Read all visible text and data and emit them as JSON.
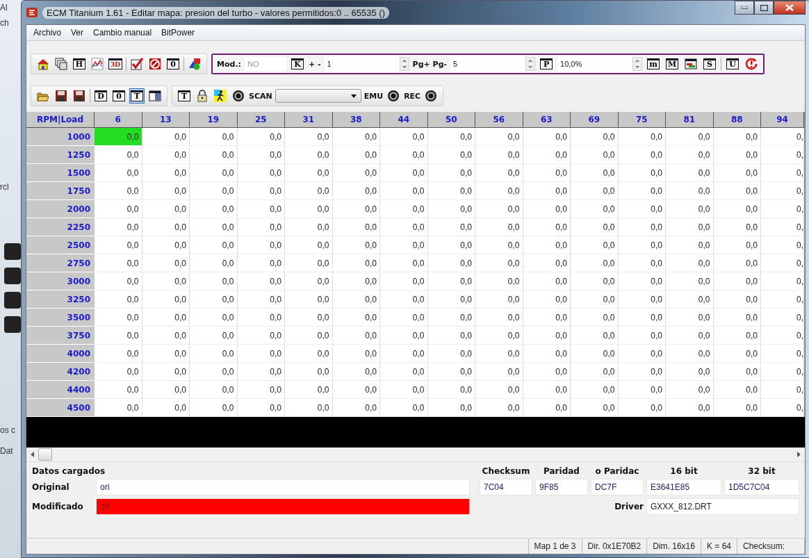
{
  "background_app": {
    "texts": [
      "Al",
      "ch",
      "rcl",
      "os c",
      "Dat"
    ]
  },
  "window": {
    "title": "ECM Titanium 1.61 - Editar mapa: presion del turbo - valores permitidos:0 .. 65535 ()"
  },
  "menu": [
    "Archivo",
    "Ver",
    "Cambio manual",
    "BitPower"
  ],
  "toolbar_1": {
    "buttons": [
      {
        "kind": "home"
      },
      {
        "kind": "pages"
      },
      {
        "kind": "letter",
        "glyph": "H"
      },
      {
        "kind": "chart"
      },
      {
        "kind": "letter",
        "glyph": "3D"
      },
      {
        "kind": "sep"
      },
      {
        "kind": "check"
      },
      {
        "kind": "forbid"
      },
      {
        "kind": "letter",
        "glyph": "0"
      },
      {
        "kind": "sep"
      },
      {
        "kind": "shapes"
      }
    ],
    "edit_bar": [
      {
        "kind": "label",
        "text": "Mod.:"
      },
      {
        "kind": "field",
        "value": "NO",
        "disabled": true
      },
      {
        "kind": "letter",
        "glyph": "K"
      },
      {
        "kind": "label",
        "text": "+ -"
      },
      {
        "kind": "spin",
        "value": "1",
        "disabled": false
      },
      {
        "kind": "label",
        "text": "Pg+ Pg-"
      },
      {
        "kind": "spin",
        "value": "5",
        "disabled": false
      },
      {
        "kind": "letter",
        "glyph": "P"
      },
      {
        "kind": "spin",
        "value": "10,0%",
        "disabled": false
      },
      {
        "kind": "letter",
        "glyph": "m"
      },
      {
        "kind": "letter",
        "glyph": "M"
      },
      {
        "kind": "colorbar"
      },
      {
        "kind": "letter",
        "glyph": "S"
      },
      {
        "kind": "sep"
      },
      {
        "kind": "letter",
        "glyph": "U"
      },
      {
        "kind": "power"
      }
    ]
  },
  "toolbar_2": {
    "buttons": [
      {
        "kind": "open",
        "pressed": false
      },
      {
        "kind": "save",
        "pressed": false
      },
      {
        "kind": "save",
        "pressed": false
      },
      {
        "kind": "sep"
      },
      {
        "kind": "letter",
        "glyph": "D",
        "pressed": false
      },
      {
        "kind": "letter",
        "glyph": "0",
        "pressed": false
      },
      {
        "kind": "letter",
        "glyph": "T",
        "pressed": true
      },
      {
        "kind": "panel",
        "pressed": false
      }
    ],
    "tools": [
      {
        "kind": "letter",
        "glyph": "T"
      },
      {
        "kind": "lock"
      },
      {
        "kind": "runner"
      },
      {
        "kind": "record"
      },
      {
        "kind": "label",
        "text": "SCAN"
      },
      {
        "kind": "dropdown"
      },
      {
        "kind": "label",
        "text": "EMU"
      },
      {
        "kind": "record"
      },
      {
        "kind": "label",
        "text": "REC"
      },
      {
        "kind": "record"
      }
    ]
  },
  "table": {
    "corner": "RPM|Load",
    "columns": [
      "6",
      "13",
      "19",
      "25",
      "31",
      "38",
      "44",
      "50",
      "56",
      "63",
      "69",
      "75",
      "81",
      "88",
      "94"
    ],
    "rows": [
      {
        "rpm": "1000",
        "cells": [
          {
            "value": "0,0",
            "selected": true
          },
          {
            "value": "0,0",
            "selected": false
          },
          {
            "value": "0,0",
            "selected": false
          },
          {
            "value": "0,0",
            "selected": false
          },
          {
            "value": "0,0",
            "selected": false
          },
          {
            "value": "0,0",
            "selected": false
          },
          {
            "value": "0,0",
            "selected": false
          },
          {
            "value": "0,0",
            "selected": false
          },
          {
            "value": "0,0",
            "selected": false
          },
          {
            "value": "0,0",
            "selected": false
          },
          {
            "value": "0,0",
            "selected": false
          },
          {
            "value": "0,0",
            "selected": false
          },
          {
            "value": "0,0",
            "selected": false
          },
          {
            "value": "0,0",
            "selected": false
          },
          {
            "value": "0,",
            "selected": false
          }
        ]
      },
      {
        "rpm": "1250",
        "cells": [
          {
            "value": "0,0",
            "selected": false
          },
          {
            "value": "0,0",
            "selected": false
          },
          {
            "value": "0,0",
            "selected": false
          },
          {
            "value": "0,0",
            "selected": false
          },
          {
            "value": "0,0",
            "selected": false
          },
          {
            "value": "0,0",
            "selected": false
          },
          {
            "value": "0,0",
            "selected": false
          },
          {
            "value": "0,0",
            "selected": false
          },
          {
            "value": "0,0",
            "selected": false
          },
          {
            "value": "0,0",
            "selected": false
          },
          {
            "value": "0,0",
            "selected": false
          },
          {
            "value": "0,0",
            "selected": false
          },
          {
            "value": "0,0",
            "selected": false
          },
          {
            "value": "0,0",
            "selected": false
          },
          {
            "value": "0,",
            "selected": false
          }
        ]
      },
      {
        "rpm": "1500",
        "cells": [
          {
            "value": "0,0",
            "selected": false
          },
          {
            "value": "0,0",
            "selected": false
          },
          {
            "value": "0,0",
            "selected": false
          },
          {
            "value": "0,0",
            "selected": false
          },
          {
            "value": "0,0",
            "selected": false
          },
          {
            "value": "0,0",
            "selected": false
          },
          {
            "value": "0,0",
            "selected": false
          },
          {
            "value": "0,0",
            "selected": false
          },
          {
            "value": "0,0",
            "selected": false
          },
          {
            "value": "0,0",
            "selected": false
          },
          {
            "value": "0,0",
            "selected": false
          },
          {
            "value": "0,0",
            "selected": false
          },
          {
            "value": "0,0",
            "selected": false
          },
          {
            "value": "0,0",
            "selected": false
          },
          {
            "value": "0,",
            "selected": false
          }
        ]
      },
      {
        "rpm": "1750",
        "cells": [
          {
            "value": "0,0",
            "selected": false
          },
          {
            "value": "0,0",
            "selected": false
          },
          {
            "value": "0,0",
            "selected": false
          },
          {
            "value": "0,0",
            "selected": false
          },
          {
            "value": "0,0",
            "selected": false
          },
          {
            "value": "0,0",
            "selected": false
          },
          {
            "value": "0,0",
            "selected": false
          },
          {
            "value": "0,0",
            "selected": false
          },
          {
            "value": "0,0",
            "selected": false
          },
          {
            "value": "0,0",
            "selected": false
          },
          {
            "value": "0,0",
            "selected": false
          },
          {
            "value": "0,0",
            "selected": false
          },
          {
            "value": "0,0",
            "selected": false
          },
          {
            "value": "0,0",
            "selected": false
          },
          {
            "value": "0,",
            "selected": false
          }
        ]
      },
      {
        "rpm": "2000",
        "cells": [
          {
            "value": "0,0",
            "selected": false
          },
          {
            "value": "0,0",
            "selected": false
          },
          {
            "value": "0,0",
            "selected": false
          },
          {
            "value": "0,0",
            "selected": false
          },
          {
            "value": "0,0",
            "selected": false
          },
          {
            "value": "0,0",
            "selected": false
          },
          {
            "value": "0,0",
            "selected": false
          },
          {
            "value": "0,0",
            "selected": false
          },
          {
            "value": "0,0",
            "selected": false
          },
          {
            "value": "0,0",
            "selected": false
          },
          {
            "value": "0,0",
            "selected": false
          },
          {
            "value": "0,0",
            "selected": false
          },
          {
            "value": "0,0",
            "selected": false
          },
          {
            "value": "0,0",
            "selected": false
          },
          {
            "value": "0,",
            "selected": false
          }
        ]
      },
      {
        "rpm": "2250",
        "cells": [
          {
            "value": "0,0",
            "selected": false
          },
          {
            "value": "0,0",
            "selected": false
          },
          {
            "value": "0,0",
            "selected": false
          },
          {
            "value": "0,0",
            "selected": false
          },
          {
            "value": "0,0",
            "selected": false
          },
          {
            "value": "0,0",
            "selected": false
          },
          {
            "value": "0,0",
            "selected": false
          },
          {
            "value": "0,0",
            "selected": false
          },
          {
            "value": "0,0",
            "selected": false
          },
          {
            "value": "0,0",
            "selected": false
          },
          {
            "value": "0,0",
            "selected": false
          },
          {
            "value": "0,0",
            "selected": false
          },
          {
            "value": "0,0",
            "selected": false
          },
          {
            "value": "0,0",
            "selected": false
          },
          {
            "value": "0,",
            "selected": false
          }
        ]
      },
      {
        "rpm": "2500",
        "cells": [
          {
            "value": "0,0",
            "selected": false
          },
          {
            "value": "0,0",
            "selected": false
          },
          {
            "value": "0,0",
            "selected": false
          },
          {
            "value": "0,0",
            "selected": false
          },
          {
            "value": "0,0",
            "selected": false
          },
          {
            "value": "0,0",
            "selected": false
          },
          {
            "value": "0,0",
            "selected": false
          },
          {
            "value": "0,0",
            "selected": false
          },
          {
            "value": "0,0",
            "selected": false
          },
          {
            "value": "0,0",
            "selected": false
          },
          {
            "value": "0,0",
            "selected": false
          },
          {
            "value": "0,0",
            "selected": false
          },
          {
            "value": "0,0",
            "selected": false
          },
          {
            "value": "0,0",
            "selected": false
          },
          {
            "value": "0,",
            "selected": false
          }
        ]
      },
      {
        "rpm": "2750",
        "cells": [
          {
            "value": "0,0",
            "selected": false
          },
          {
            "value": "0,0",
            "selected": false
          },
          {
            "value": "0,0",
            "selected": false
          },
          {
            "value": "0,0",
            "selected": false
          },
          {
            "value": "0,0",
            "selected": false
          },
          {
            "value": "0,0",
            "selected": false
          },
          {
            "value": "0,0",
            "selected": false
          },
          {
            "value": "0,0",
            "selected": false
          },
          {
            "value": "0,0",
            "selected": false
          },
          {
            "value": "0,0",
            "selected": false
          },
          {
            "value": "0,0",
            "selected": false
          },
          {
            "value": "0,0",
            "selected": false
          },
          {
            "value": "0,0",
            "selected": false
          },
          {
            "value": "0,0",
            "selected": false
          },
          {
            "value": "0,",
            "selected": false
          }
        ]
      },
      {
        "rpm": "3000",
        "cells": [
          {
            "value": "0,0",
            "selected": false
          },
          {
            "value": "0,0",
            "selected": false
          },
          {
            "value": "0,0",
            "selected": false
          },
          {
            "value": "0,0",
            "selected": false
          },
          {
            "value": "0,0",
            "selected": false
          },
          {
            "value": "0,0",
            "selected": false
          },
          {
            "value": "0,0",
            "selected": false
          },
          {
            "value": "0,0",
            "selected": false
          },
          {
            "value": "0,0",
            "selected": false
          },
          {
            "value": "0,0",
            "selected": false
          },
          {
            "value": "0,0",
            "selected": false
          },
          {
            "value": "0,0",
            "selected": false
          },
          {
            "value": "0,0",
            "selected": false
          },
          {
            "value": "0,0",
            "selected": false
          },
          {
            "value": "0,",
            "selected": false
          }
        ]
      },
      {
        "rpm": "3250",
        "cells": [
          {
            "value": "0,0",
            "selected": false
          },
          {
            "value": "0,0",
            "selected": false
          },
          {
            "value": "0,0",
            "selected": false
          },
          {
            "value": "0,0",
            "selected": false
          },
          {
            "value": "0,0",
            "selected": false
          },
          {
            "value": "0,0",
            "selected": false
          },
          {
            "value": "0,0",
            "selected": false
          },
          {
            "value": "0,0",
            "selected": false
          },
          {
            "value": "0,0",
            "selected": false
          },
          {
            "value": "0,0",
            "selected": false
          },
          {
            "value": "0,0",
            "selected": false
          },
          {
            "value": "0,0",
            "selected": false
          },
          {
            "value": "0,0",
            "selected": false
          },
          {
            "value": "0,0",
            "selected": false
          },
          {
            "value": "0,",
            "selected": false
          }
        ]
      },
      {
        "rpm": "3500",
        "cells": [
          {
            "value": "0,0",
            "selected": false
          },
          {
            "value": "0,0",
            "selected": false
          },
          {
            "value": "0,0",
            "selected": false
          },
          {
            "value": "0,0",
            "selected": false
          },
          {
            "value": "0,0",
            "selected": false
          },
          {
            "value": "0,0",
            "selected": false
          },
          {
            "value": "0,0",
            "selected": false
          },
          {
            "value": "0,0",
            "selected": false
          },
          {
            "value": "0,0",
            "selected": false
          },
          {
            "value": "0,0",
            "selected": false
          },
          {
            "value": "0,0",
            "selected": false
          },
          {
            "value": "0,0",
            "selected": false
          },
          {
            "value": "0,0",
            "selected": false
          },
          {
            "value": "0,0",
            "selected": false
          },
          {
            "value": "0,",
            "selected": false
          }
        ]
      },
      {
        "rpm": "3750",
        "cells": [
          {
            "value": "0,0",
            "selected": false
          },
          {
            "value": "0,0",
            "selected": false
          },
          {
            "value": "0,0",
            "selected": false
          },
          {
            "value": "0,0",
            "selected": false
          },
          {
            "value": "0,0",
            "selected": false
          },
          {
            "value": "0,0",
            "selected": false
          },
          {
            "value": "0,0",
            "selected": false
          },
          {
            "value": "0,0",
            "selected": false
          },
          {
            "value": "0,0",
            "selected": false
          },
          {
            "value": "0,0",
            "selected": false
          },
          {
            "value": "0,0",
            "selected": false
          },
          {
            "value": "0,0",
            "selected": false
          },
          {
            "value": "0,0",
            "selected": false
          },
          {
            "value": "0,0",
            "selected": false
          },
          {
            "value": "0,",
            "selected": false
          }
        ]
      },
      {
        "rpm": "4000",
        "cells": [
          {
            "value": "0,0",
            "selected": false
          },
          {
            "value": "0,0",
            "selected": false
          },
          {
            "value": "0,0",
            "selected": false
          },
          {
            "value": "0,0",
            "selected": false
          },
          {
            "value": "0,0",
            "selected": false
          },
          {
            "value": "0,0",
            "selected": false
          },
          {
            "value": "0,0",
            "selected": false
          },
          {
            "value": "0,0",
            "selected": false
          },
          {
            "value": "0,0",
            "selected": false
          },
          {
            "value": "0,0",
            "selected": false
          },
          {
            "value": "0,0",
            "selected": false
          },
          {
            "value": "0,0",
            "selected": false
          },
          {
            "value": "0,0",
            "selected": false
          },
          {
            "value": "0,0",
            "selected": false
          },
          {
            "value": "0,",
            "selected": false
          }
        ]
      },
      {
        "rpm": "4200",
        "cells": [
          {
            "value": "0,0",
            "selected": false
          },
          {
            "value": "0,0",
            "selected": false
          },
          {
            "value": "0,0",
            "selected": false
          },
          {
            "value": "0,0",
            "selected": false
          },
          {
            "value": "0,0",
            "selected": false
          },
          {
            "value": "0,0",
            "selected": false
          },
          {
            "value": "0,0",
            "selected": false
          },
          {
            "value": "0,0",
            "selected": false
          },
          {
            "value": "0,0",
            "selected": false
          },
          {
            "value": "0,0",
            "selected": false
          },
          {
            "value": "0,0",
            "selected": false
          },
          {
            "value": "0,0",
            "selected": false
          },
          {
            "value": "0,0",
            "selected": false
          },
          {
            "value": "0,0",
            "selected": false
          },
          {
            "value": "0,",
            "selected": false
          }
        ]
      },
      {
        "rpm": "4400",
        "cells": [
          {
            "value": "0,0",
            "selected": false
          },
          {
            "value": "0,0",
            "selected": false
          },
          {
            "value": "0,0",
            "selected": false
          },
          {
            "value": "0,0",
            "selected": false
          },
          {
            "value": "0,0",
            "selected": false
          },
          {
            "value": "0,0",
            "selected": false
          },
          {
            "value": "0,0",
            "selected": false
          },
          {
            "value": "0,0",
            "selected": false
          },
          {
            "value": "0,0",
            "selected": false
          },
          {
            "value": "0,0",
            "selected": false
          },
          {
            "value": "0,0",
            "selected": false
          },
          {
            "value": "0,0",
            "selected": false
          },
          {
            "value": "0,0",
            "selected": false
          },
          {
            "value": "0,0",
            "selected": false
          },
          {
            "value": "0,",
            "selected": false
          }
        ]
      },
      {
        "rpm": "4500",
        "cells": [
          {
            "value": "0,0",
            "selected": false
          },
          {
            "value": "0,0",
            "selected": false
          },
          {
            "value": "0,0",
            "selected": false
          },
          {
            "value": "0,0",
            "selected": false
          },
          {
            "value": "0,0",
            "selected": false
          },
          {
            "value": "0,0",
            "selected": false
          },
          {
            "value": "0,0",
            "selected": false
          },
          {
            "value": "0,0",
            "selected": false
          },
          {
            "value": "0,0",
            "selected": false
          },
          {
            "value": "0,0",
            "selected": false
          },
          {
            "value": "0,0",
            "selected": false
          },
          {
            "value": "0,0",
            "selected": false
          },
          {
            "value": "0,0",
            "selected": false
          },
          {
            "value": "0,0",
            "selected": false
          },
          {
            "value": "0,",
            "selected": false
          }
        ]
      }
    ]
  },
  "loaded_data": {
    "title": "Datos cargados",
    "files": [
      {
        "label": "Original",
        "value": "ori",
        "changed": false
      },
      {
        "label": "Modificado",
        "value": "ori",
        "changed": true
      }
    ],
    "checksums": [
      {
        "label": "Checksum",
        "value": "7C04"
      },
      {
        "label": "Paridad",
        "value": "9F85"
      },
      {
        "label": "o Paridac",
        "value": "DC7F"
      },
      {
        "label": "16 bit",
        "value": "E3641E85"
      },
      {
        "label": "32 bit",
        "value": "1D5C7C04"
      }
    ],
    "driver": {
      "label": "Driver",
      "value": "GXXX_812.DRT"
    }
  },
  "status_bar": [
    "Map 1 de 3",
    "Dir. 0x1E70B2",
    "Dim. 16x16",
    "K = 64",
    "Checksum:"
  ]
}
